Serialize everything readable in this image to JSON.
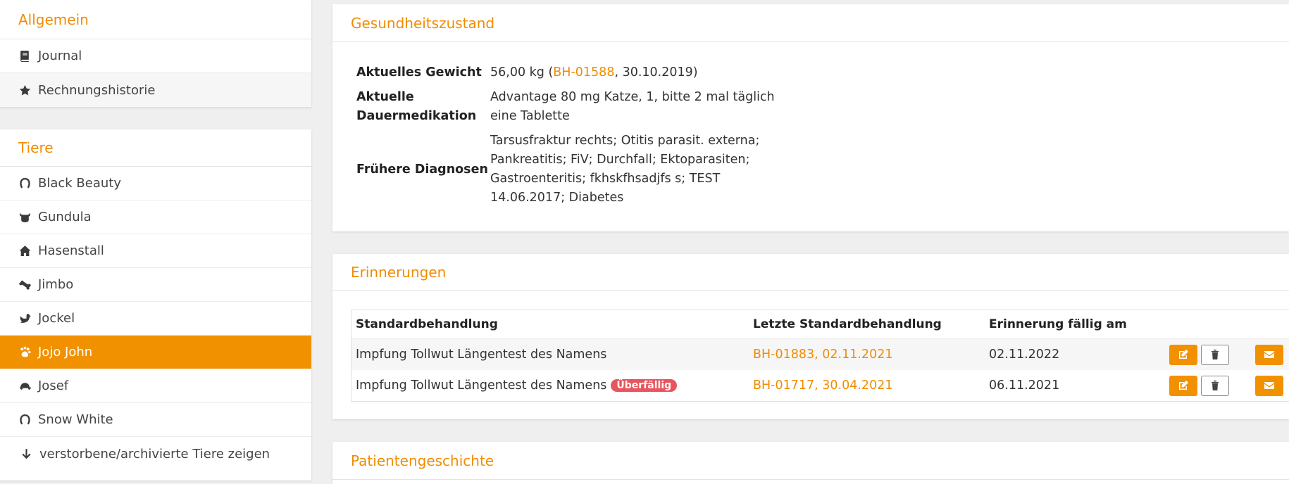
{
  "sidebar": {
    "general": {
      "title": "Allgemein",
      "items": [
        {
          "label": "Journal",
          "icon": "book-icon"
        },
        {
          "label": "Rechnungshistorie",
          "icon": "star-icon"
        }
      ]
    },
    "animals": {
      "title": "Tiere",
      "items": [
        {
          "label": "Black Beauty",
          "icon": "horseshoe-icon"
        },
        {
          "label": "Gundula",
          "icon": "cow-icon"
        },
        {
          "label": "Hasenstall",
          "icon": "home-icon"
        },
        {
          "label": "Jimbo",
          "icon": "bone-icon"
        },
        {
          "label": "Jockel",
          "icon": "bird-icon"
        },
        {
          "label": "Jojo John",
          "icon": "paw-icon"
        },
        {
          "label": "Josef",
          "icon": "turtle-icon"
        },
        {
          "label": "Snow White",
          "icon": "horseshoe-icon"
        },
        {
          "label": "verstorbene/archivierte Tiere zeigen",
          "icon": "arrow-down-icon"
        }
      ],
      "active_item": "Jojo John"
    }
  },
  "health": {
    "title": "Gesundheitszustand",
    "weight_label": "Aktuelles Gewicht",
    "weight_prefix": "56,00 kg (",
    "weight_link": "BH-01588",
    "weight_suffix": ", 30.10.2019)",
    "medication_label": "Aktuelle Dauermedikation",
    "medication_value": "Advantage 80 mg Katze, 1, bitte 2 mal täglich eine Tablette",
    "diagnoses_label": "Frühere Diagnosen",
    "diagnoses_value": "Tarsusfraktur rechts; Otitis parasit. externa; Pankreatitis; FiV; Durchfall; Ektoparasiten; Gastroenteritis; fkhskfhsadjfs s; TEST 14.06.2017; Diabetes"
  },
  "reminders": {
    "title": "Erinnerungen",
    "columns": [
      "Standardbehandlung",
      "Letzte Standardbehandlung",
      "Erinnerung fällig am"
    ],
    "rows": [
      {
        "treatment": "Impfung Tollwut Längentest des Namens",
        "badge": "",
        "last": "BH-01883, 02.11.2021",
        "due": "02.11.2022"
      },
      {
        "treatment": "Impfung Tollwut Längentest des Namens",
        "badge": "Überfällig",
        "last": "BH-01717, 30.04.2021",
        "due": "06.11.2021"
      }
    ]
  },
  "history": {
    "title": "Patientengeschichte"
  },
  "colors": {
    "accent": "#f29100",
    "overdue": "#e8555f"
  }
}
